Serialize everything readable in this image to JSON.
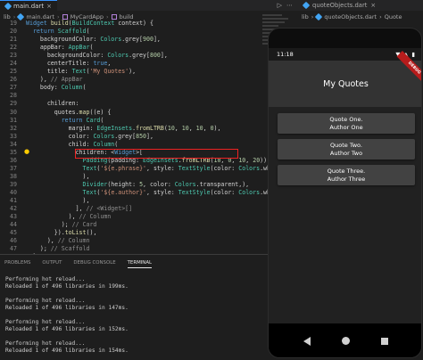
{
  "editor": {
    "tabs": [
      {
        "label": "main.dart",
        "close": "×"
      }
    ],
    "tabbar_actions": [
      "▷",
      "⋯"
    ],
    "breadcrumb": [
      "lib",
      "main.dart",
      "MyCardApp",
      "build"
    ],
    "code_lines": [
      {
        "n": "19",
        "t": "Widget build(BuildContext context) {"
      },
      {
        "n": "20",
        "t": "  return Scaffold("
      },
      {
        "n": "21",
        "t": "    backgroundColor: Colors.grey[900],"
      },
      {
        "n": "22",
        "t": "    appBar: AppBar("
      },
      {
        "n": "23",
        "t": "      backgroundColor: Colors.grey[800],"
      },
      {
        "n": "24",
        "t": "      centerTitle: true,"
      },
      {
        "n": "25",
        "t": "      title: Text('My Quotes'),"
      },
      {
        "n": "26",
        "t": "    ), // AppBar"
      },
      {
        "n": "27",
        "t": "    body: Column("
      },
      {
        "n": "28",
        "t": ""
      },
      {
        "n": "29",
        "t": "      children:"
      },
      {
        "n": "30",
        "t": "        quotes.map((e) {"
      },
      {
        "n": "31",
        "t": "          return Card("
      },
      {
        "n": "32",
        "t": "            margin: EdgeInsets.fromLTRB(10, 10, 10, 0),"
      },
      {
        "n": "33",
        "t": "            color: Colors.grey[850],"
      },
      {
        "n": "34",
        "t": "            child: Column("
      },
      {
        "n": "35",
        "t": "              children: <Widget>["
      },
      {
        "n": "36",
        "t": "                Padding(padding: EdgeInsets.fromLTRB(10, 0, 10, 20)),"
      },
      {
        "n": "37",
        "t": "                Text('${e.phrase}', style: TextStyle(color: Colors.white60)"
      },
      {
        "n": "38",
        "t": "                ),"
      },
      {
        "n": "39",
        "t": "                Divider(height: 5, color: Colors.transparent,),"
      },
      {
        "n": "40",
        "t": "                Text('${e.author}', style: TextStyle(color: Colors.white60)"
      },
      {
        "n": "41",
        "t": "                ),"
      },
      {
        "n": "42",
        "t": "              ], // <Widget>[]"
      },
      {
        "n": "43",
        "t": "            ), // Column"
      },
      {
        "n": "44",
        "t": "          ); // Card"
      },
      {
        "n": "45",
        "t": "        }).toList(),"
      },
      {
        "n": "46",
        "t": "      ), // Column"
      },
      {
        "n": "47",
        "t": "    ); // Scaffold"
      },
      {
        "n": "48",
        "t": "  }"
      },
      {
        "n": "49",
        "t": "}"
      }
    ]
  },
  "panel": {
    "tabs": [
      "PROBLEMS",
      "OUTPUT",
      "DEBUG CONSOLE",
      "TERMINAL"
    ],
    "active_tab": "TERMINAL",
    "terminal_lines": [
      "Performing hot reload...",
      "Reloaded 1 of 496 libraries in 199ms.",
      "",
      "Performing hot reload...",
      "Reloaded 1 of 496 libraries in 147ms.",
      "",
      "Performing hot reload...",
      "Reloaded 1 of 496 libraries in 152ms.",
      "",
      "Performing hot reload...",
      "Reloaded 1 of 496 libraries in 154ms."
    ]
  },
  "right_editor": {
    "tab_label": "quoteObjects.dart",
    "tab_close": "×",
    "breadcrumb": [
      "lib",
      "quoteObjects.dart",
      "Quote"
    ]
  },
  "phone": {
    "time": "11:18",
    "status_icons": [
      "▼",
      "▲",
      "▮"
    ],
    "app_title": "My Quotes",
    "debug_banner": "DEBUG",
    "cards": [
      {
        "phrase": "Quote One.",
        "author": "Author One"
      },
      {
        "phrase": "Quote Two.",
        "author": "Author Two"
      },
      {
        "phrase": "Quote Three.",
        "author": "Author Three"
      }
    ],
    "colors": {
      "app_bar": "#333333",
      "body": "#212121",
      "card": "#424242",
      "banner": "#b71c1c"
    }
  }
}
